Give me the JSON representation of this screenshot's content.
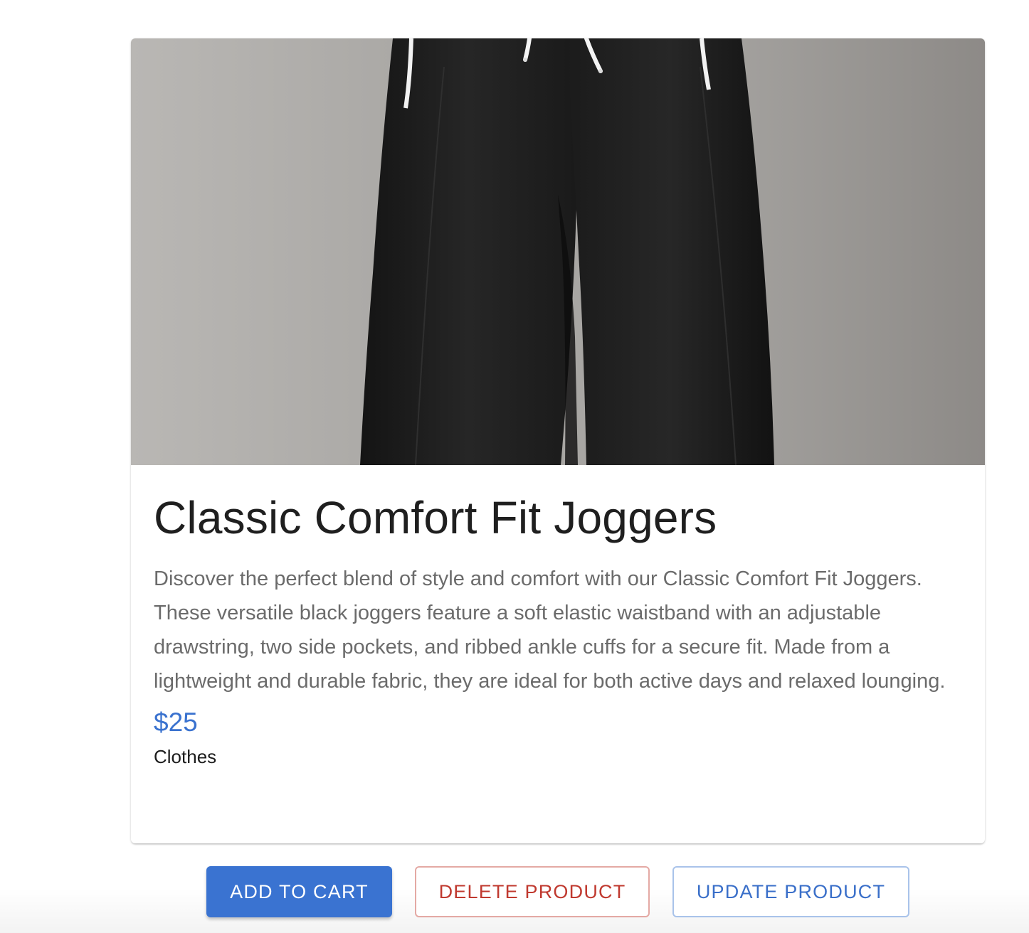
{
  "product": {
    "image_alt": "Black joggers with white drawstrings hanging against a gray background",
    "title": "Classic Comfort Fit Joggers",
    "description": "Discover the perfect blend of style and comfort with our Classic Comfort Fit Joggers. These versatile black joggers feature a soft elastic waistband with an adjustable drawstring, two side pockets, and ribbed ankle cuffs for a secure fit. Made from a lightweight and durable fabric, they are ideal for both active days and relaxed lounging.",
    "price": "$25",
    "category": "Clothes"
  },
  "actions": {
    "add_to_cart": "ADD TO CART",
    "delete_product": "DELETE PRODUCT",
    "update_product": "UPDATE PRODUCT"
  },
  "colors": {
    "primary": "#3a73d1",
    "danger": "#c0392f",
    "price": "#3a72cf"
  }
}
